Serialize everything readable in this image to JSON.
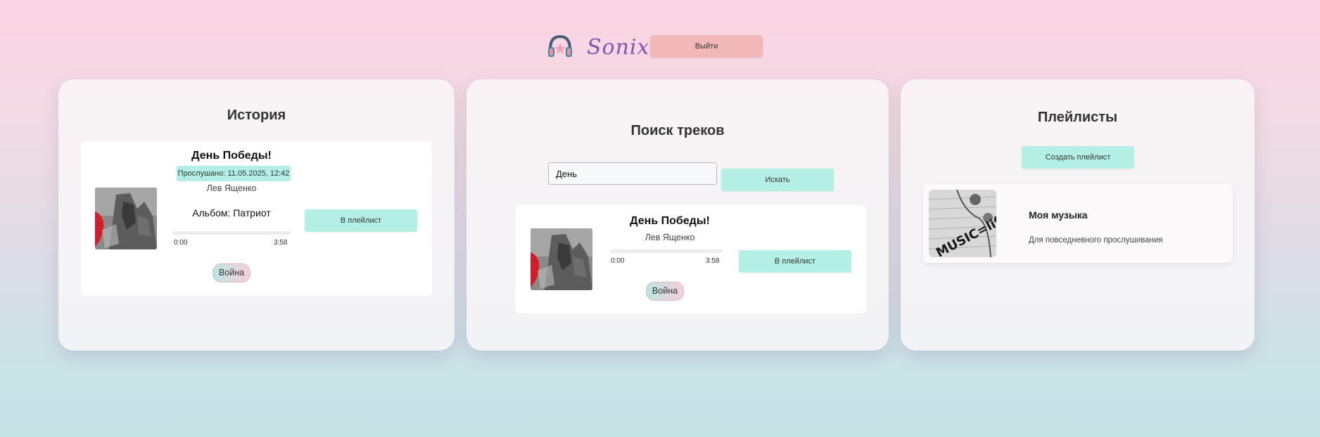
{
  "header": {
    "brand": "Sonix",
    "logout_label": "Выйти",
    "logo_icon": "headphones-icon"
  },
  "history": {
    "title": "История",
    "track": {
      "title": "День Победы!",
      "listened": "Прослушано: 11.05.2025, 12:42",
      "artist": "Лев Ященко",
      "album": "Альбом: Патриот",
      "time_current": "0:00",
      "time_total": "3:58",
      "progress": 0,
      "tag": "Война",
      "add_label": "В плейлист"
    }
  },
  "search": {
    "title": "Поиск треков",
    "query": "День",
    "search_label": "Искать",
    "result": {
      "title": "День Победы!",
      "artist": "Лев Ященко",
      "time_current": "0:00",
      "time_total": "3:58",
      "progress": 0,
      "tag": "Война",
      "add_label": "В плейлист"
    }
  },
  "playlists": {
    "title": "Плейлисты",
    "create_label": "Создать плейлист",
    "items": [
      {
        "name": "Моя музыка",
        "description": "Для повседневного прослушивания"
      }
    ]
  },
  "colors": {
    "accent_mint": "#b4efe5",
    "logout_pink": "#f2b8b8",
    "brand_purple": "#7f58b0"
  }
}
